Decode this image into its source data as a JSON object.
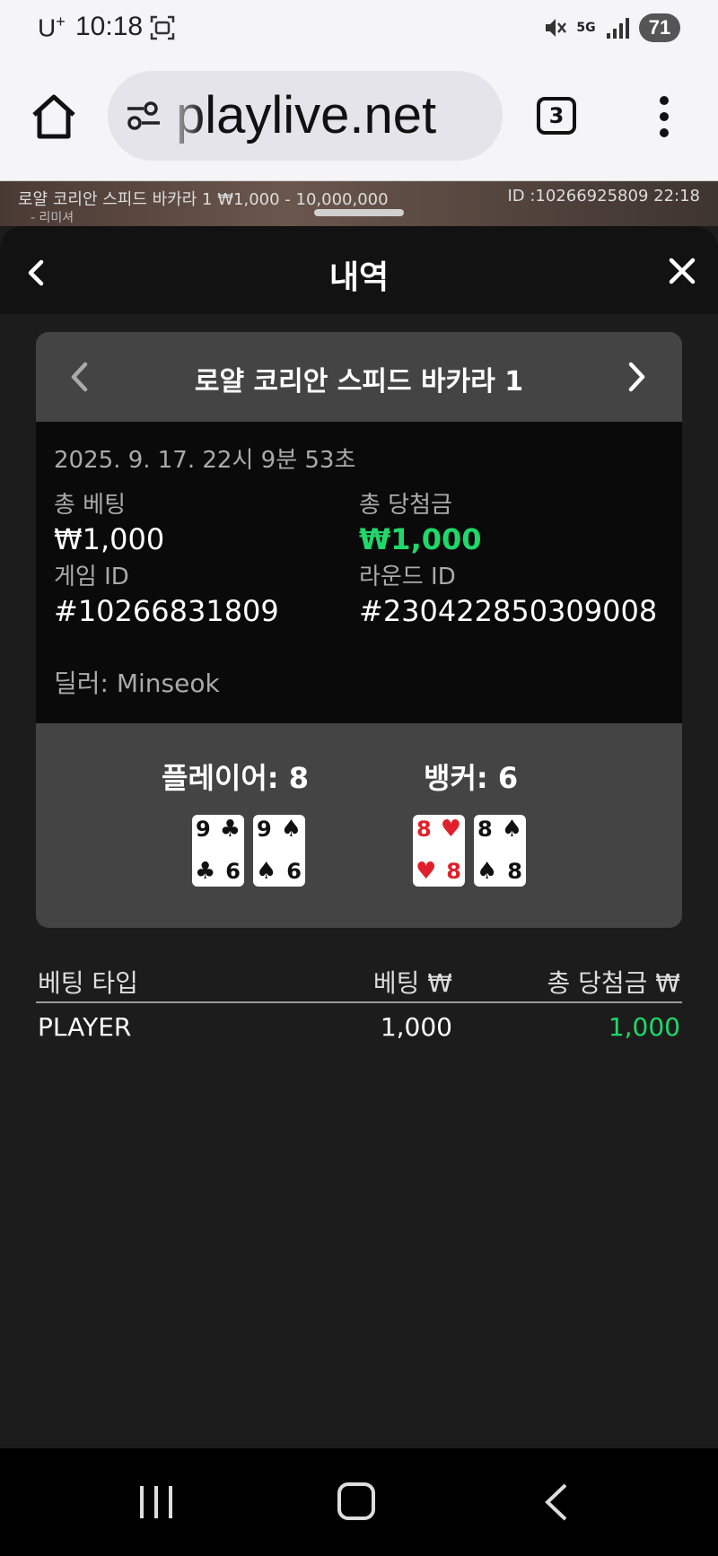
{
  "status_bar": {
    "carrier": "U",
    "carrier_sup": "+",
    "time": "10:18",
    "network": "5G",
    "battery": "71"
  },
  "browser": {
    "url_text": "playlive.net",
    "tab_count": "3"
  },
  "game_strip": {
    "info": "로얄 코리안 스피드 바카라 1 ₩1,000 - 10,000,000",
    "round_info": "ID :10266925809 22:18",
    "sub": "- 리미셔"
  },
  "sheet": {
    "title": "내역",
    "game_name": "로얄 코리안 스피드 바카라 1",
    "date": "2025. 9. 17. 22시 9분 53초",
    "total_bet_label": "총 베팅",
    "total_bet_value": "₩1,000",
    "total_win_label": "총 당첨금",
    "total_win_value": "₩1,000",
    "game_id_label": "게임 ID",
    "game_id_value": "#10266831809",
    "round_id_label": "라운드 ID",
    "round_id_value": "#230422850309008",
    "dealer": "딜러: Minseok"
  },
  "result": {
    "player_title": "플레이어: 8",
    "banker_title": "뱅커: 6",
    "player_cards": [
      {
        "rank": "9",
        "suit": "♣",
        "corner_rank": "6",
        "corner_suit": "♣",
        "color": "black"
      },
      {
        "rank": "9",
        "suit": "♠",
        "corner_rank": "6",
        "corner_suit": "♠",
        "color": "black"
      }
    ],
    "banker_cards": [
      {
        "rank": "8",
        "suit": "♥",
        "corner_rank": "8",
        "corner_suit": "♥",
        "color": "red"
      },
      {
        "rank": "8",
        "suit": "♠",
        "corner_rank": "8",
        "corner_suit": "♠",
        "color": "black"
      }
    ]
  },
  "bets_table": {
    "headers": [
      "베팅 타입",
      "베팅 ₩",
      "총 당첨금 ₩"
    ],
    "rows": [
      {
        "type": "PLAYER",
        "bet": "1,000",
        "win": "1,000"
      }
    ]
  },
  "colors": {
    "win_green": "#1fd86a",
    "sheet_bg": "#1c1c1c",
    "card_nav_bg": "#444444"
  }
}
